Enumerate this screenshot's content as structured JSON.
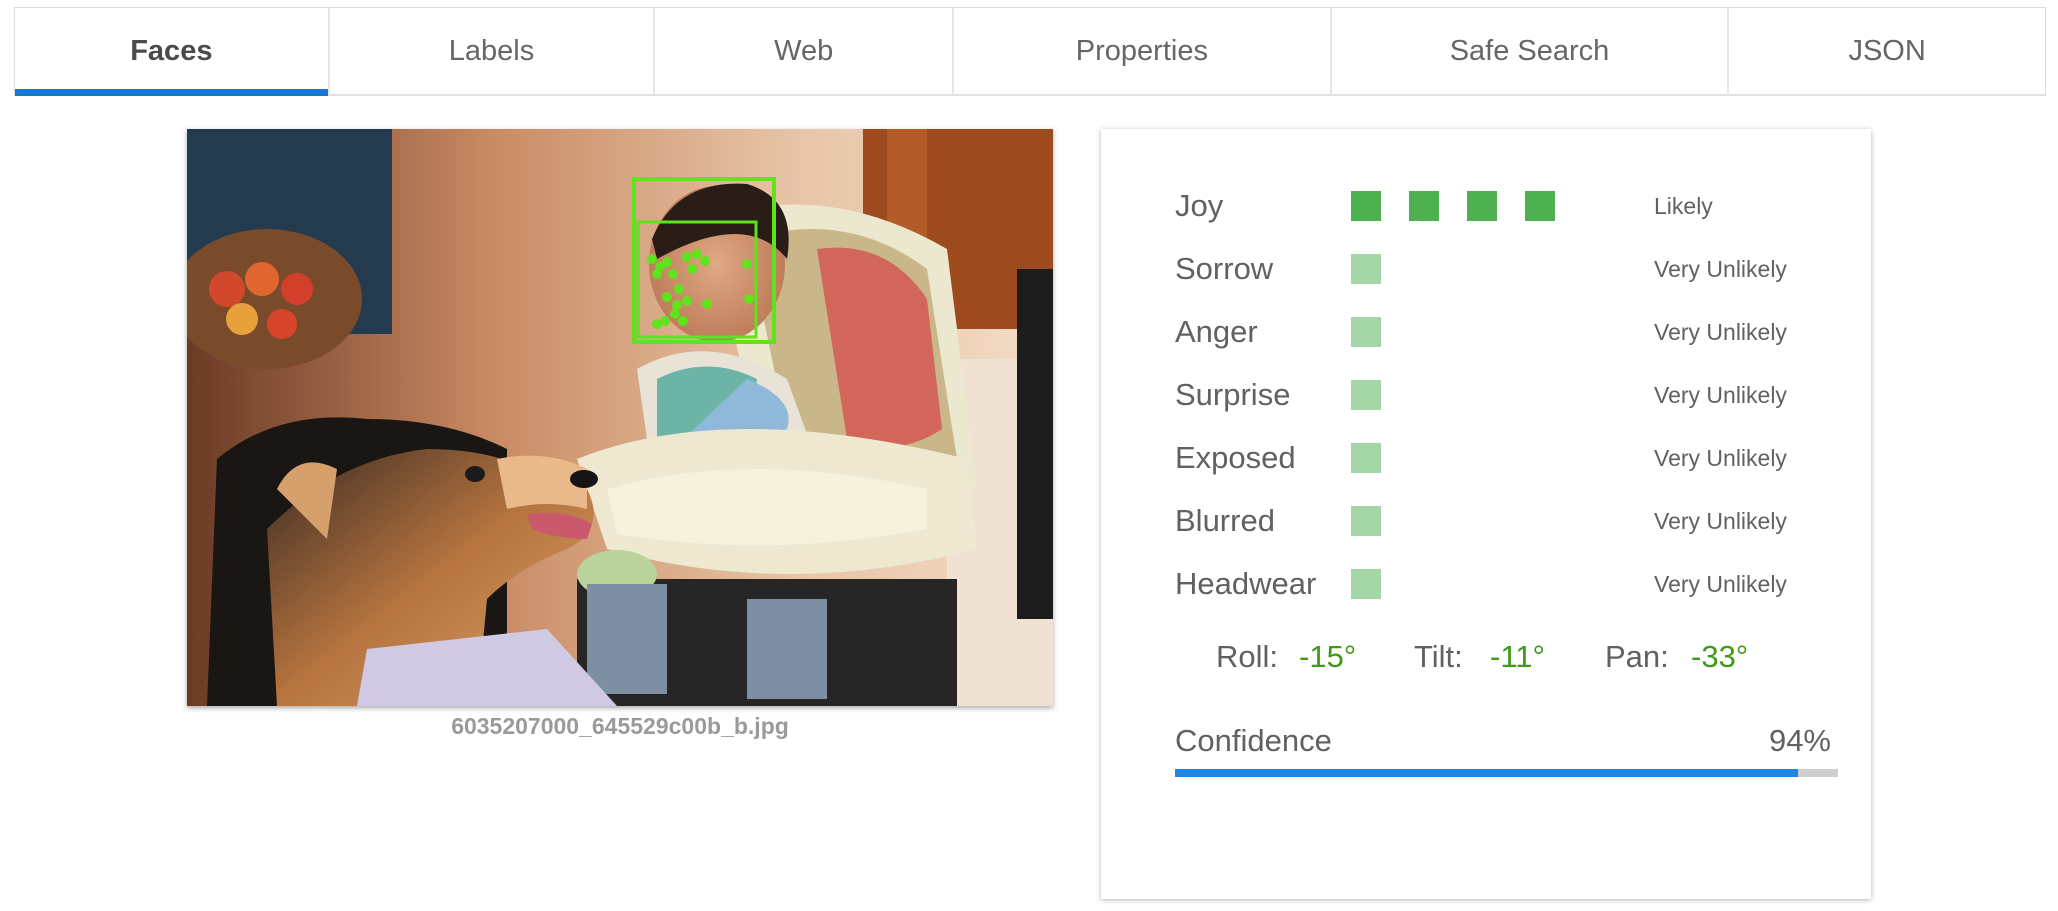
{
  "tabs": [
    {
      "label": "Faces",
      "active": true
    },
    {
      "label": "Labels",
      "active": false
    },
    {
      "label": "Web",
      "active": false
    },
    {
      "label": "Properties",
      "active": false
    },
    {
      "label": "Safe Search",
      "active": false
    },
    {
      "label": "JSON",
      "active": false
    }
  ],
  "image": {
    "filename": "6035207000_645529c00b_b.jpg",
    "content": "photo-baby-in-highchair-feeding-dog",
    "annotation_color": "#5fe31b"
  },
  "face": {
    "likelihoods": [
      {
        "name": "Joy",
        "value": "Likely",
        "level": 4
      },
      {
        "name": "Sorrow",
        "value": "Very Unlikely",
        "level": 1
      },
      {
        "name": "Anger",
        "value": "Very Unlikely",
        "level": 1
      },
      {
        "name": "Surprise",
        "value": "Very Unlikely",
        "level": 1
      },
      {
        "name": "Exposed",
        "value": "Very Unlikely",
        "level": 1
      },
      {
        "name": "Blurred",
        "value": "Very Unlikely",
        "level": 1
      },
      {
        "name": "Headwear",
        "value": "Very Unlikely",
        "level": 1
      }
    ],
    "angles": {
      "roll_label": "Roll:",
      "roll": "-15°",
      "tilt_label": "Tilt:",
      "tilt": "-11°",
      "pan_label": "Pan:",
      "pan": "-33°"
    },
    "confidence": {
      "label": "Confidence",
      "value": "94%",
      "fraction": 0.94
    }
  },
  "colors": {
    "active_tab_underline": "#1976d2",
    "likely_box": "#4caf50",
    "unlikely_box": "#a5d6a7",
    "angle_value": "#3f9a1a",
    "confidence_bar": "#1e88e5"
  }
}
